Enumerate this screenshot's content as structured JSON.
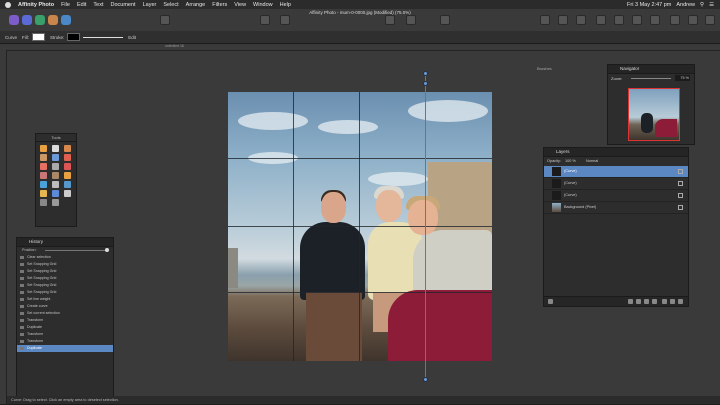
{
  "menubar": {
    "app_name": "Affinity Photo",
    "items": [
      "File",
      "Edit",
      "Text",
      "Document",
      "Layer",
      "Select",
      "Arrange",
      "Filters",
      "View",
      "Window",
      "Help"
    ],
    "datetime": "Fri 3 May  2:47 pm",
    "user": "Andrew"
  },
  "window": {
    "title": "Affinity Photo - mum-0-0000.jpg (Modified) (75.0%)"
  },
  "context": {
    "curve_label": "Curve",
    "fill_label": "Fill:",
    "stroke_label": "Stroke:",
    "edit_label": "Edit"
  },
  "ruler": {
    "guide_label": "unlimited 16"
  },
  "tools_panel": {
    "title": "Tools"
  },
  "history": {
    "title": "History",
    "position_label": "Position:",
    "items": [
      "Clear selection",
      "Set Snapping Grid",
      "Set Snapping Grid",
      "Set Snapping Grid",
      "Set Snapping Grid",
      "Set Snapping Grid",
      "Set line weight",
      "Create curve",
      "Set current selection",
      "Transform",
      "Duplicate",
      "Transform",
      "Transform",
      "Duplicate"
    ]
  },
  "navigator": {
    "title": "Navigator",
    "zoom_label": "Zoom:",
    "zoom_value": "75 %"
  },
  "brushes_tab": "Brushes",
  "layers": {
    "title": "Layers",
    "opacity_label": "Opacity:",
    "opacity_value": "100 %",
    "blend_mode": "Normal",
    "rows": [
      {
        "name": "(Curve)",
        "selected": true
      },
      {
        "name": "(Curve)",
        "selected": false
      },
      {
        "name": "(Curve)",
        "selected": false
      },
      {
        "name": "Background",
        "suffix": "(Pixel)",
        "selected": false
      }
    ]
  },
  "status": {
    "text": "Curve: Drag to select. Click an empty area to deselect selection."
  },
  "colors": {
    "accent": "#5b87c3",
    "guide": "#4a7bc0",
    "panel": "#2d2d2d",
    "canvas": "#3a3a3a"
  }
}
